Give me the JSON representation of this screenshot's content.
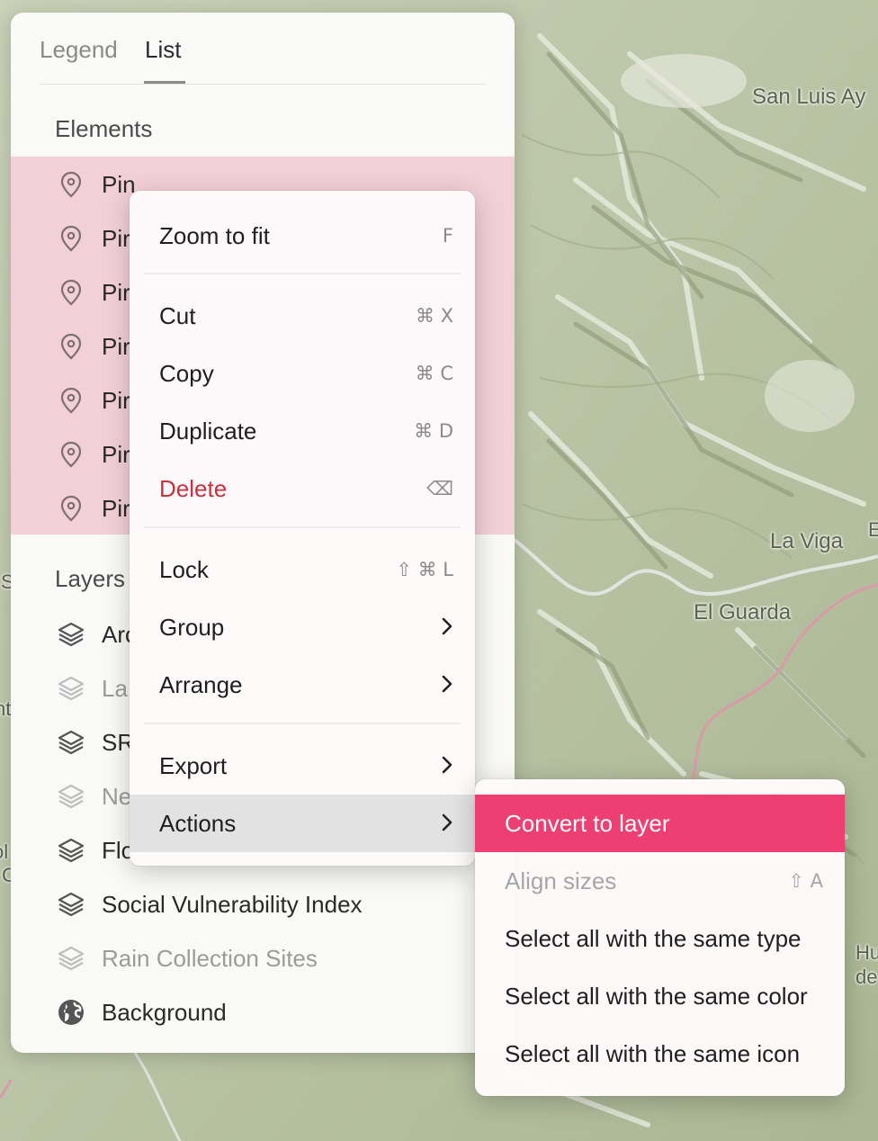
{
  "map": {
    "labels": [
      "San Luis Ay",
      "La Viga",
      "El Guarda",
      "E",
      "Hu",
      "de",
      "S",
      "nt",
      "ol",
      "C"
    ],
    "colors": {
      "base": "#b9c4a6",
      "ridge_light": "#e6eadc",
      "ridge_dark": "#8d9978",
      "road": "#d7d9d2",
      "road_pink": "#d79aa6"
    }
  },
  "panel": {
    "tabs": [
      "Legend",
      "List"
    ],
    "active_tab": "List",
    "elements_header": "Elements",
    "layers_header": "Layers",
    "elements": [
      {
        "label": "Pin",
        "icon": "map-pin-icon"
      },
      {
        "label": "Pir",
        "icon": "map-pin-icon"
      },
      {
        "label": "Pir",
        "icon": "map-pin-icon"
      },
      {
        "label": "Pir",
        "icon": "map-pin-icon"
      },
      {
        "label": "Pir",
        "icon": "map-pin-icon"
      },
      {
        "label": "Pir",
        "icon": "map-pin-icon"
      },
      {
        "label": "Pir",
        "icon": "map-pin-icon"
      }
    ],
    "layers": [
      {
        "label": "Arc",
        "icon": "layers-icon",
        "dim": false
      },
      {
        "label": "La",
        "icon": "layers-icon",
        "dim": true
      },
      {
        "label": "SR",
        "icon": "layers-icon",
        "dim": false
      },
      {
        "label": "Ne",
        "icon": "layers-icon",
        "dim": true
      },
      {
        "label": "Flo",
        "icon": "layers-icon",
        "dim": false
      },
      {
        "label": "Social Vulnerability Index",
        "icon": "layers-icon",
        "dim": false
      },
      {
        "label": "Rain Collection Sites",
        "icon": "layers-icon",
        "dim": true
      },
      {
        "label": "Background",
        "icon": "globe-icon",
        "dim": false
      }
    ],
    "colors": {
      "selection": "#f3d0d7"
    }
  },
  "context_menu": {
    "items": [
      {
        "label": "Zoom to fit",
        "shortcut": "F"
      },
      {
        "label": "Cut",
        "shortcut": "⌘ X"
      },
      {
        "label": "Copy",
        "shortcut": "⌘ C"
      },
      {
        "label": "Duplicate",
        "shortcut": "⌘ D"
      },
      {
        "label": "Delete",
        "shortcut": "⌫"
      },
      {
        "label": "Lock",
        "shortcut": "⇧ ⌘ L"
      },
      {
        "label": "Group",
        "submenu": true
      },
      {
        "label": "Arrange",
        "submenu": true
      },
      {
        "label": "Export",
        "submenu": true
      },
      {
        "label": "Actions",
        "submenu": true
      }
    ],
    "colors": {
      "danger": "#c8323f",
      "hover": "#e2e2e2"
    }
  },
  "actions_submenu": {
    "items": [
      {
        "label": "Convert to layer",
        "state": "highlighted"
      },
      {
        "label": "Align sizes",
        "shortcut": "⇧ A",
        "state": "disabled"
      },
      {
        "label": "Select all with the same type"
      },
      {
        "label": "Select all with the same color"
      },
      {
        "label": "Select all with the same icon"
      }
    ],
    "colors": {
      "accent": "#ee3f72"
    }
  }
}
